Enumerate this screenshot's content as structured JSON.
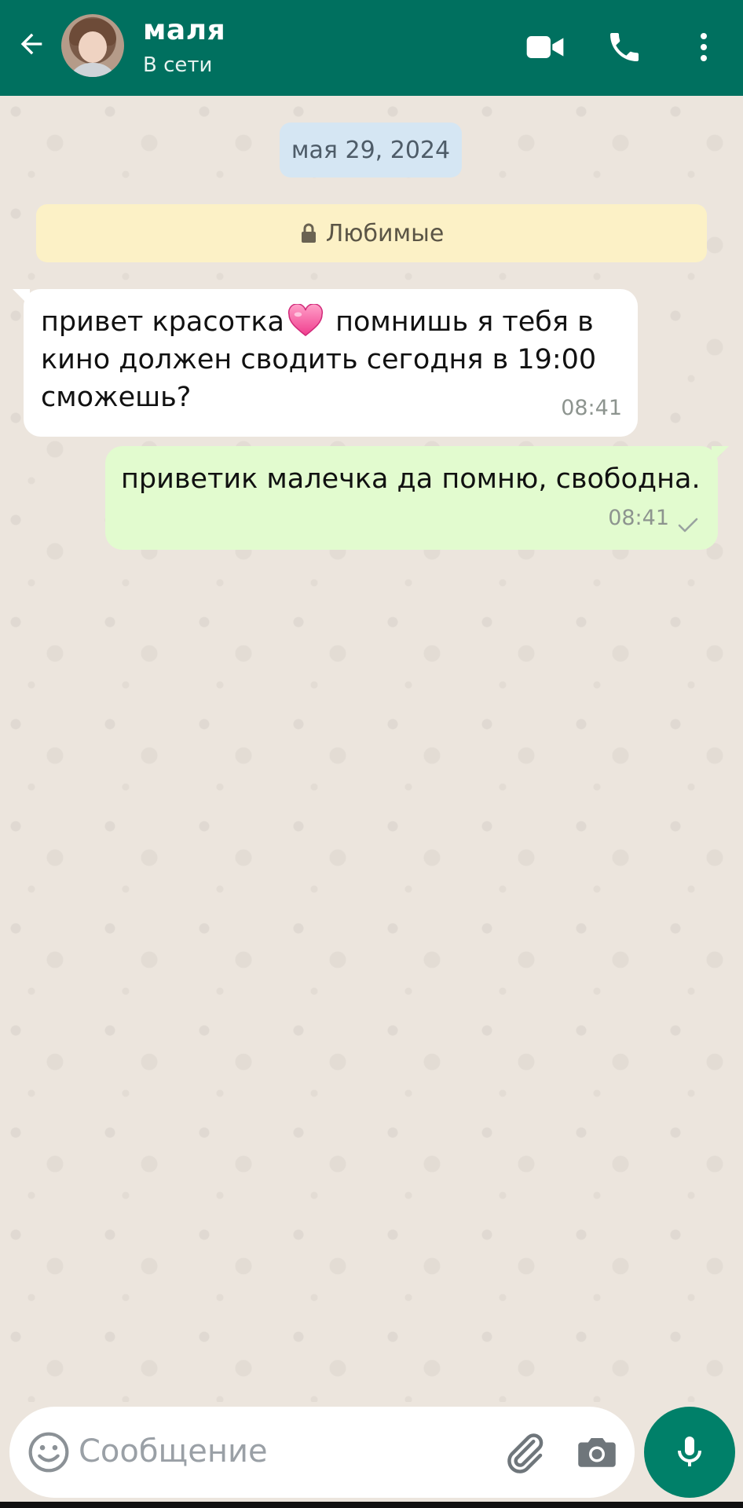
{
  "header": {
    "contact_name": "маля",
    "status": "В сети",
    "icons": [
      "back-arrow-icon",
      "video-call-icon",
      "phone-call-icon",
      "more-vert-icon"
    ],
    "color": "#00705f"
  },
  "chat": {
    "date_chip": "мая 29, 2024",
    "favorites_label": "Любимые",
    "messages": [
      {
        "direction": "incoming",
        "text_part1": "привет красотка",
        "emoji": "💗",
        "text_part2": " помнишь я тебя в кино должен сводить сегодня в 19:00 сможешь?",
        "time": "08:41"
      },
      {
        "direction": "outgoing",
        "text": "приветик малечка да помню, свободна.",
        "time": "08:41",
        "status": "sent-single-check"
      }
    ]
  },
  "composer": {
    "placeholder": "Сообщение",
    "value": "",
    "icons": [
      "emoji-icon",
      "attach-icon",
      "camera-icon",
      "microphone-icon"
    ],
    "send_button_color": "#008069"
  }
}
